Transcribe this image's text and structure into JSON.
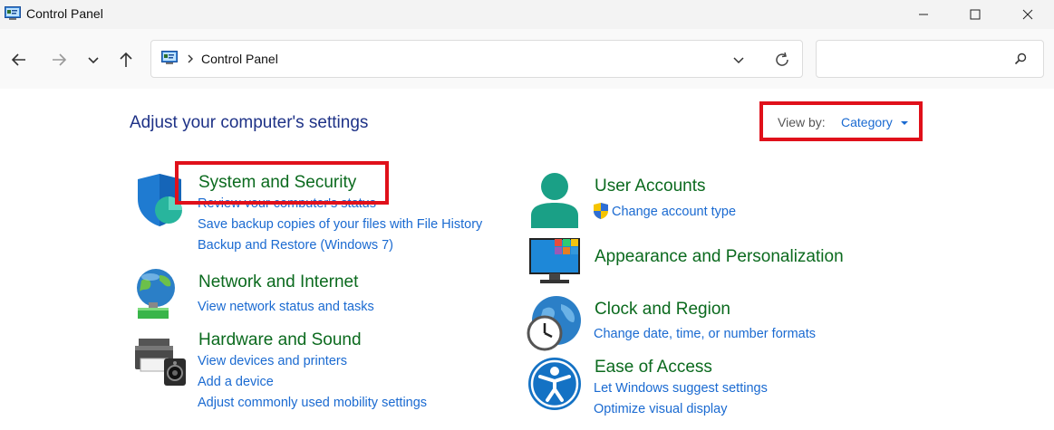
{
  "window": {
    "title": "Control Panel",
    "icon": "control-panel-icon"
  },
  "toolbar": {
    "address": "Control Panel",
    "search_placeholder": ""
  },
  "main": {
    "heading": "Adjust your computer's settings",
    "view_by": {
      "label": "View by:",
      "value": "Category"
    }
  },
  "categories": {
    "system": {
      "title": "System and Security",
      "icon": "shield-icon",
      "links": [
        "Review your computer's status",
        "Save backup copies of your files with File History",
        "Backup and Restore (Windows 7)"
      ]
    },
    "network": {
      "title": "Network and Internet",
      "icon": "network-globe-icon",
      "links": [
        "View network status and tasks"
      ]
    },
    "hardware": {
      "title": "Hardware and Sound",
      "icon": "printer-speaker-icon",
      "links": [
        "View devices and printers",
        "Add a device",
        "Adjust commonly used mobility settings"
      ]
    },
    "users": {
      "title": "User Accounts",
      "icon": "user-icon",
      "links": [
        "Change account type"
      ]
    },
    "appearance": {
      "title": "Appearance and Personalization",
      "icon": "monitor-icon",
      "links": []
    },
    "clock": {
      "title": "Clock and Region",
      "icon": "clock-globe-icon",
      "links": [
        "Change date, time, or number formats"
      ]
    },
    "ease": {
      "title": "Ease of Access",
      "icon": "accessibility-icon",
      "links": [
        "Let Windows suggest settings",
        "Optimize visual display"
      ]
    }
  },
  "colors": {
    "heading": "#1e3287",
    "category_title": "#0b6a1e",
    "link": "#1a6ad1",
    "highlight": "#e0101a"
  }
}
